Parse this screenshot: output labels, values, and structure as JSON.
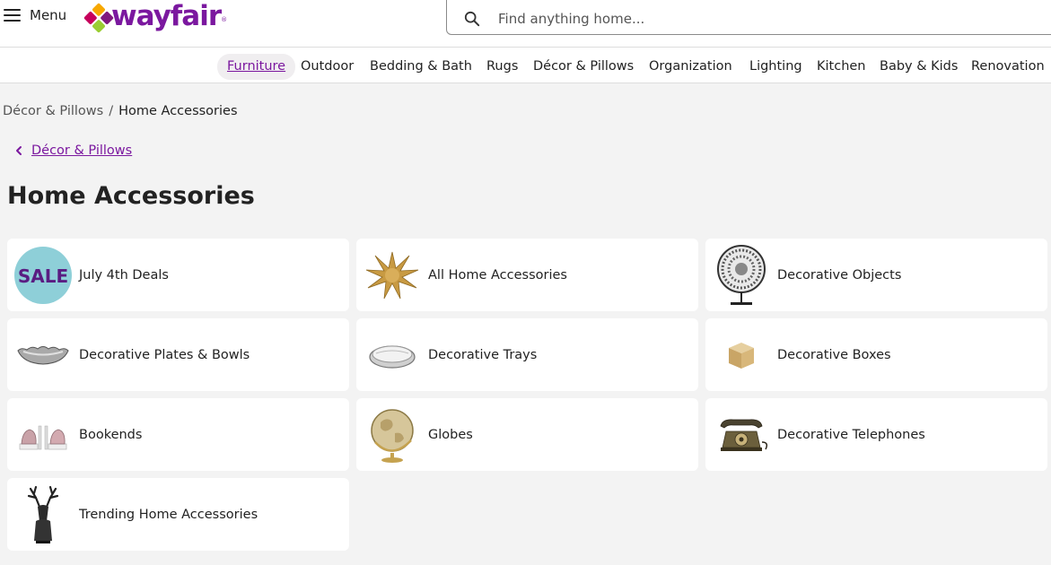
{
  "header": {
    "menu_label": "Menu",
    "logo_text": "wayfair",
    "logo_mark": "®",
    "brand_color": "#7b189f",
    "search_placeholder": "Find anything home..."
  },
  "nav": {
    "items": [
      {
        "label": "Furniture",
        "active": true
      },
      {
        "label": "Outdoor"
      },
      {
        "label": "Bedding & Bath"
      },
      {
        "label": "Rugs"
      },
      {
        "label": "Décor & Pillows"
      },
      {
        "label": "Organization"
      },
      {
        "label": "Lighting"
      },
      {
        "label": "Kitchen"
      },
      {
        "label": "Baby & Kids"
      },
      {
        "label": "Renovation"
      }
    ]
  },
  "breadcrumb": {
    "parent": "Décor & Pillows",
    "separator": "/",
    "current": "Home Accessories"
  },
  "back_link": {
    "label": "Décor & Pillows"
  },
  "page_title": "Home Accessories",
  "categories": [
    {
      "label": "July 4th Deals",
      "icon": "sale-badge-icon",
      "badge_text": "SALE"
    },
    {
      "label": "All Home Accessories",
      "icon": "gold-star-sculpture-icon"
    },
    {
      "label": "Decorative Objects",
      "icon": "mosaic-disc-sculpture-icon"
    },
    {
      "label": "Decorative Plates & Bowls",
      "icon": "silver-bowl-icon"
    },
    {
      "label": "Decorative Trays",
      "icon": "mirror-tray-icon"
    },
    {
      "label": "Decorative Boxes",
      "icon": "wooden-box-icon"
    },
    {
      "label": "Bookends",
      "icon": "geode-bookends-icon"
    },
    {
      "label": "Globes",
      "icon": "antique-globe-icon"
    },
    {
      "label": "Decorative Telephones",
      "icon": "vintage-telephone-icon"
    },
    {
      "label": "Trending Home Accessories",
      "icon": "deer-head-icon"
    }
  ]
}
